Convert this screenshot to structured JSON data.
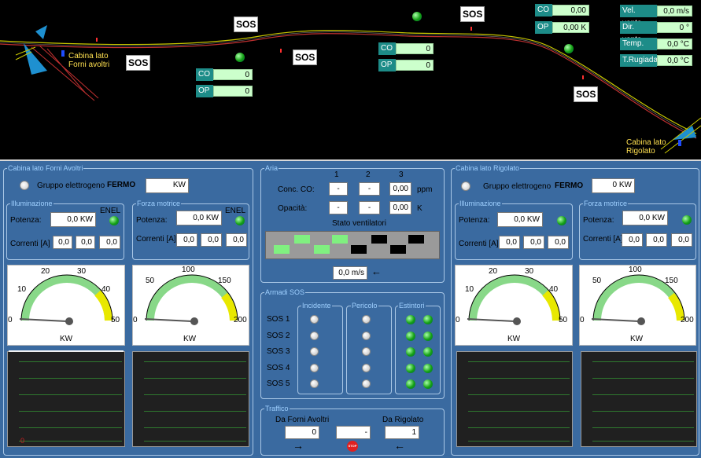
{
  "map": {
    "sos_label": "SOS",
    "cabina_left": [
      "Cabina lato",
      "Forni avoltri"
    ],
    "cabina_right": [
      "Cabina lato",
      "Rigolato"
    ],
    "sensor_a": {
      "co_tag": "CO",
      "co_val": "0",
      "op_tag": "OP",
      "op_val": "0"
    },
    "sensor_b": {
      "co_tag": "CO",
      "co_val": "0",
      "op_tag": "OP",
      "op_val": "0"
    },
    "sensor_c": {
      "co_tag": "CO",
      "co_val": "0,00",
      "op_tag": "OP",
      "op_val": "0,00 K"
    },
    "weather": [
      {
        "label": "Vel. vento",
        "value": "0,0 m/s"
      },
      {
        "label": "Dir. vento",
        "value": "0 °"
      },
      {
        "label": "Temp.",
        "value": "0,0 °C"
      },
      {
        "label": "T.Rugiada",
        "value": "0,0 °C"
      }
    ]
  },
  "left": {
    "title": "Cabina lato Forni Avoltri",
    "gen_label": "Gruppo elettrogeno",
    "gen_state": "FERMO",
    "gen_value": "KW",
    "ill": {
      "title": "Illuminazione",
      "potenza_label": "Potenza:",
      "potenza": "0,0 KW",
      "enel": "ENEL",
      "correnti_label": "Correnti [A]",
      "c1": "0,0",
      "c2": "0,0",
      "c3": "0,0"
    },
    "fm": {
      "title": "Forza motrice",
      "potenza_label": "Potenza:",
      "potenza": "0,0 KW",
      "enel": "ENEL",
      "correnti_label": "Correnti [A]",
      "c1": "0,0",
      "c2": "0,0",
      "c3": "0,0"
    },
    "gauge1": {
      "ticks": [
        "0",
        "10",
        "20",
        "30",
        "40",
        "50"
      ],
      "unit": "KW"
    },
    "gauge2": {
      "ticks": [
        "0",
        "50",
        "100",
        "150",
        "200"
      ],
      "unit": "KW"
    },
    "scope_mark": "0"
  },
  "right": {
    "title": "Cabina lato Rigolato",
    "gen_label": "Gruppo elettrogeno",
    "gen_state": "FERMO",
    "gen_value": "0 KW",
    "ill": {
      "title": "Illuminazione",
      "potenza_label": "Potenza:",
      "potenza": "0,0 KW",
      "correnti_label": "Correnti [A]",
      "c1": "0,0",
      "c2": "0,0",
      "c3": "0,0"
    },
    "fm": {
      "title": "Forza motrice",
      "potenza_label": "Potenza:",
      "potenza": "0,0 KW",
      "correnti_label": "Correnti [A]",
      "c1": "0,0",
      "c2": "0,0",
      "c3": "0,0"
    },
    "gauge1": {
      "ticks": [
        "0",
        "10",
        "20",
        "30",
        "40",
        "50"
      ],
      "unit": "KW"
    },
    "gauge2": {
      "ticks": [
        "0",
        "50",
        "100",
        "150",
        "200"
      ],
      "unit": "KW"
    }
  },
  "aria": {
    "title": "Aria",
    "cols": [
      "1",
      "2",
      "3"
    ],
    "conc_label": "Conc. CO:",
    "conc": [
      "-",
      "-",
      "0,00"
    ],
    "conc_unit": "ppm",
    "opac_label": "Opacità:",
    "opac": [
      "-",
      "-",
      "0,00"
    ],
    "opac_unit": "K",
    "vent_label": "Stato ventilatori",
    "wind": "0,0 m/s"
  },
  "sos": {
    "title": "Armadi SOS",
    "incidente": "Incidente",
    "pericolo": "Pericolo",
    "estintori": "Estintori",
    "rows": [
      "SOS 1",
      "SOS 2",
      "SOS 3",
      "SOS 4",
      "SOS 5"
    ]
  },
  "traffico": {
    "title": "Traffico",
    "left_label": "Da Forni Avoltri",
    "left_val": "0",
    "mid_val": "-",
    "right_label": "Da Rigolato",
    "right_val": "1",
    "stop": "STOP"
  }
}
